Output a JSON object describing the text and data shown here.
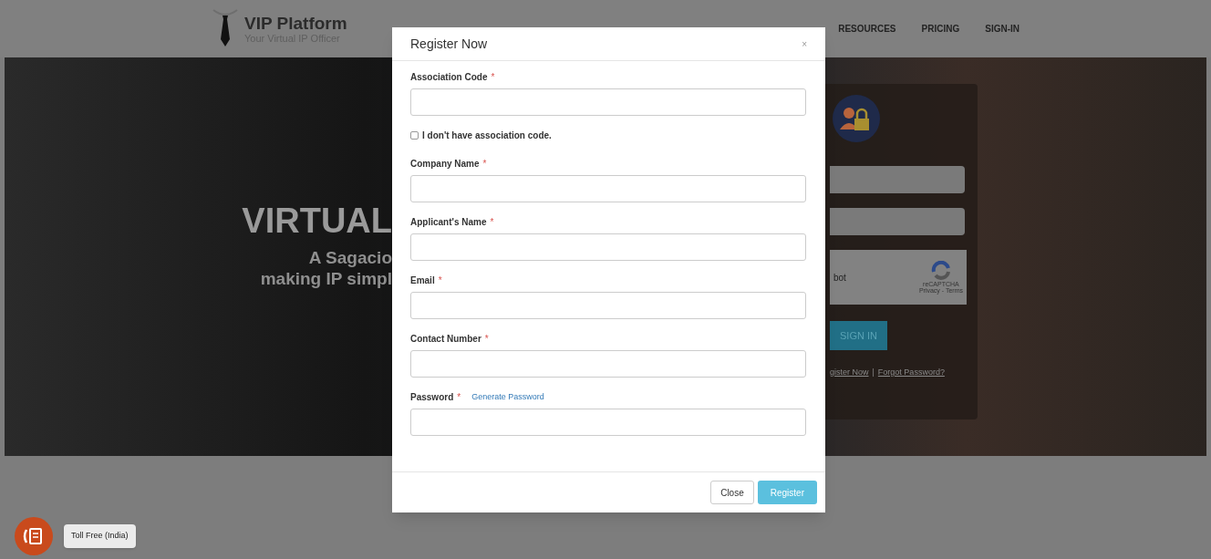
{
  "nav": {
    "logo_title": "VIP Platform",
    "logo_tagline": "Your Virtual IP Officer",
    "links": [
      "RESOURCES",
      "PRICING",
      "SIGN-IN"
    ]
  },
  "hero": {
    "heading": "VIRTUAL",
    "line_1": "A Sagacio",
    "line_2": "making IP simpl"
  },
  "login_panel": {
    "captcha_label": "bot",
    "captcha_brand": "reCAPTCHA",
    "captcha_links": "Privacy - Terms",
    "sign_in_button": "SIGN IN",
    "register_link": "gister Now",
    "separator": "|",
    "forgot_link": "Forgot Password?"
  },
  "modal": {
    "title": "Register Now",
    "close": "×",
    "fields": [
      {
        "kind": "field",
        "label": "Association Code",
        "required_mark": "*"
      },
      {
        "kind": "checkbox",
        "label": "I don't have association code.",
        "checked": false
      },
      {
        "kind": "field",
        "label": "Company Name",
        "required_mark": "*"
      },
      {
        "kind": "field",
        "label": "Applicant's Name",
        "required_mark": "*"
      },
      {
        "kind": "field",
        "label": "Email",
        "required_mark": "*"
      },
      {
        "kind": "field",
        "label": "Contact Number",
        "required_mark": "*"
      },
      {
        "kind": "field",
        "label": "Password",
        "required_mark": "*",
        "link": "Generate Password"
      }
    ],
    "buttons": [
      {
        "kind": "secondary",
        "label": "Close"
      },
      {
        "kind": "primary",
        "label": "Register"
      }
    ]
  },
  "toll_free": {
    "tooltip": "Toll Free (India)"
  }
}
